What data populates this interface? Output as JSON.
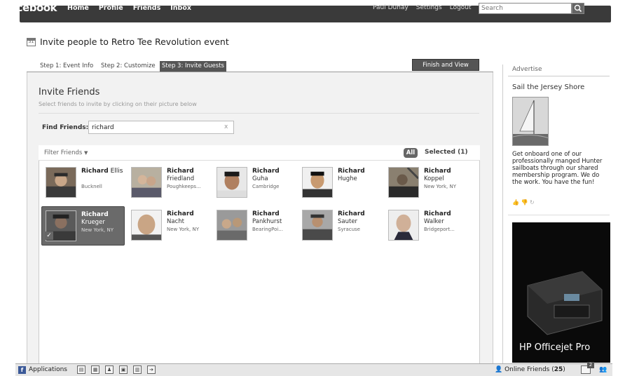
{
  "topbar": {
    "logo": "facebook",
    "nav": [
      "Home",
      "Profile",
      "Friends",
      "Inbox"
    ],
    "user": "Paul Dunay",
    "settings": "Settings",
    "logout": "Logout",
    "search_placeholder": "Search"
  },
  "page": {
    "title": "Invite people to Retro Tee Revolution event",
    "calendar_day": "31"
  },
  "tabs": {
    "step1": "Step 1: Event Info",
    "step2": "Step 2: Customize",
    "step3": "Step 3: Invite Guests",
    "finish": "Finish and View"
  },
  "invite": {
    "title": "Invite Friends",
    "subtitle": "Select friends to invite by clicking on their picture below",
    "find_label": "Find Friends:",
    "find_value": "richard",
    "clear": "x",
    "filter_label": "Filter Friends",
    "all_label": "All",
    "selected_label": "Selected (1)"
  },
  "friends": [
    {
      "first": "Richard",
      "first_rest": " Ellis",
      "last": "",
      "network": "Bucknell",
      "selected": false
    },
    {
      "first": "Richard",
      "first_rest": "",
      "last": "Friedland",
      "network": "Poughkeeps...",
      "selected": false
    },
    {
      "first": "Richard",
      "first_rest": "",
      "last": "Guha",
      "network": "Cambridge",
      "selected": false
    },
    {
      "first": "Richard",
      "first_rest": "",
      "last": "Hughe",
      "network": "",
      "selected": false
    },
    {
      "first": "Richard",
      "first_rest": "",
      "last": "Koppel",
      "network": "New York, NY",
      "selected": false
    },
    {
      "first": "Richard",
      "first_rest": "",
      "last": "Krueger",
      "network": "New York, NY",
      "selected": true
    },
    {
      "first": "Richard",
      "first_rest": "",
      "last": "Nacht",
      "network": "New York, NY",
      "selected": false
    },
    {
      "first": "Richard",
      "first_rest": "",
      "last": "Pankhurst",
      "network": "BearingPoi...",
      "selected": false
    },
    {
      "first": "Richard",
      "first_rest": "",
      "last": "Sauter",
      "network": "Syracuse",
      "selected": false
    },
    {
      "first": "Richard",
      "first_rest": "",
      "last": "Walker",
      "network": "Bridgeport...",
      "selected": false
    }
  ],
  "ads": {
    "heading": "Advertise",
    "title": "Sail the Jersey Shore",
    "text": "Get onboard one of our professionally manged Hunter sailboats through our shared membership program. We do the work. You have the fun!",
    "banner_text": "HP Officejet Pro"
  },
  "bottombar": {
    "applications": "Applications",
    "online_label": "Online Friends (",
    "online_count": "25",
    "online_close": ")",
    "notif_count": "2"
  },
  "icons": {
    "search": "search-icon",
    "calendar": "calendar-icon",
    "facebook_square": "facebook-app-icon",
    "person": "person-icon",
    "chat": "chat-icon"
  }
}
